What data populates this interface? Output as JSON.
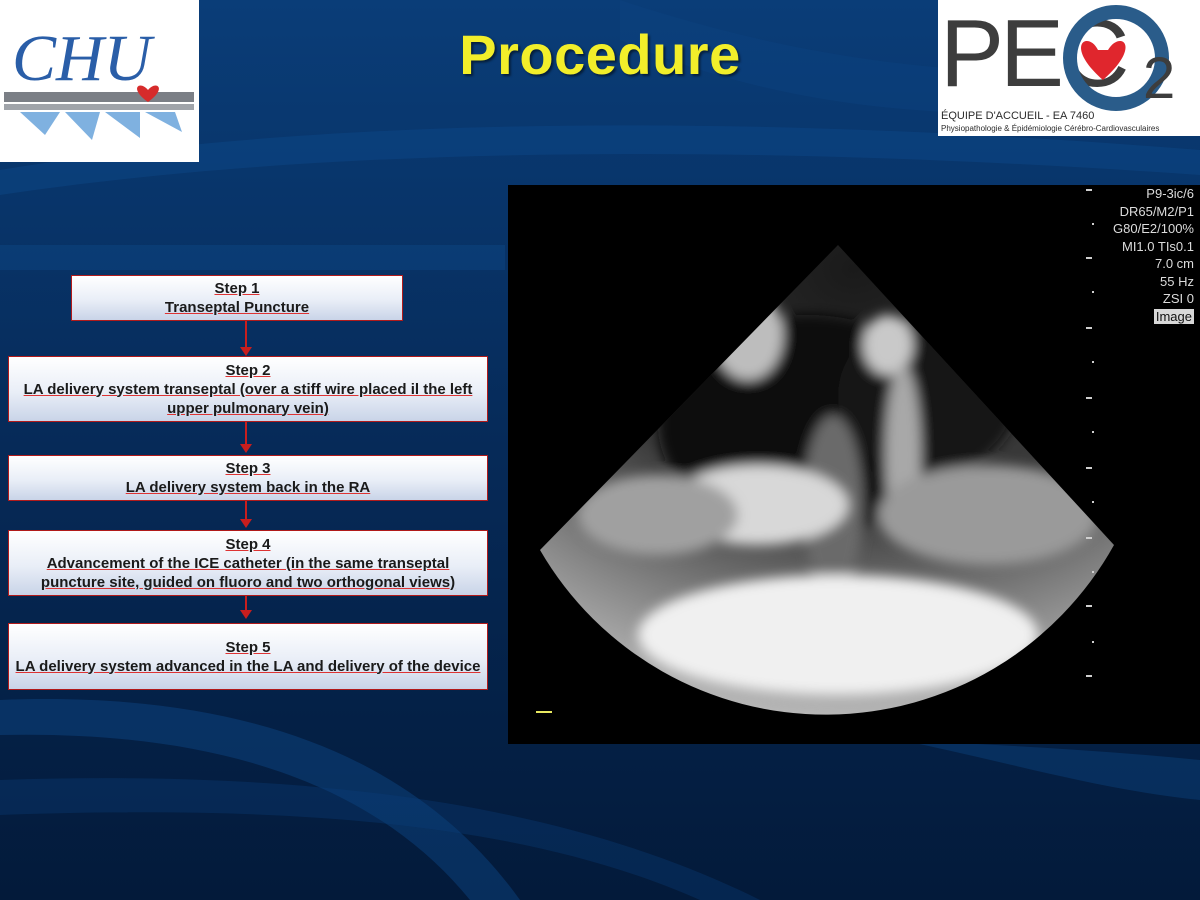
{
  "title": "Procedure",
  "logos": {
    "chu": {
      "text": "CHU",
      "heart_color": "#d62b2b"
    },
    "pec": {
      "letters": "PEC",
      "number": "2",
      "subtitle": "ÉQUIPE D'ACCUEIL - EA 7460",
      "subtitle2": "Physiopathologie & Épidémiologie Cérébro-Cardiovasculaires",
      "heart_color": "#e0262d"
    }
  },
  "steps": [
    {
      "heading": "Step 1",
      "text": "Transeptal Puncture"
    },
    {
      "heading": "Step 2",
      "text": "LA delivery system transeptal (over a stiff wire placed il the left upper  pulmonary vein)"
    },
    {
      "heading": "Step 3",
      "text": "LA delivery system back in the RA"
    },
    {
      "heading": "Step 4",
      "text": "Advancement of the ICE catheter (in the same transeptal puncture site, guided on fluoro and two orthogonal views)"
    },
    {
      "heading": "Step 5",
      "text": "LA delivery system advanced in the LA and delivery of the device"
    }
  ],
  "ultrasound": {
    "params": [
      "P9-3ic/6",
      "DR65/M2/P1",
      "G80/E2/100%",
      "MI1.0  TIs0.1",
      "7.0 cm",
      "55 Hz",
      "ZSI 0",
      "Image"
    ]
  },
  "colors": {
    "title": "#f2ee2a",
    "arrow": "#c81e1e",
    "background": "#05224a"
  }
}
